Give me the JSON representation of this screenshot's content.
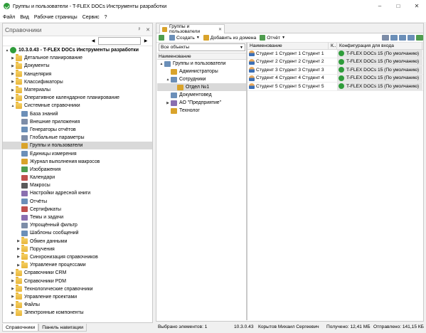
{
  "window": {
    "title": "Группы и пользователи - T-FLEX DOCs Инструменты разработки",
    "minimize": "–",
    "maximize": "□",
    "close": "✕"
  },
  "menu": [
    "Файл",
    "Вид",
    "Рабочие страницы",
    "Сервис",
    "?"
  ],
  "left_panel": {
    "title": "Справочники",
    "pin": "ᵖ",
    "close": "✕",
    "nav_prev": "◀",
    "nav_next": "▶",
    "tree": [
      {
        "label": "10.3.0.43 - T-FLEX DOCs Инструменты разработки",
        "level": 0,
        "toggle": "▲",
        "icon": "root",
        "bold": true
      },
      {
        "label": "Детальное планирование",
        "level": 1,
        "toggle": "▶",
        "icon": "folder"
      },
      {
        "label": "Документы",
        "level": 1,
        "toggle": "▶",
        "icon": "folder"
      },
      {
        "label": "Канцелярия",
        "level": 1,
        "toggle": "▶",
        "icon": "folder"
      },
      {
        "label": "Классификаторы",
        "level": 1,
        "toggle": "▶",
        "icon": "folder"
      },
      {
        "label": "Материалы",
        "level": 1,
        "toggle": "▶",
        "icon": "folder"
      },
      {
        "label": "Оперативное календарное планирование",
        "level": 1,
        "toggle": "▶",
        "icon": "folder"
      },
      {
        "label": "Системные справочники",
        "level": 1,
        "toggle": "▲",
        "icon": "folder"
      },
      {
        "label": "База знаний",
        "level": 2,
        "toggle": "",
        "icon": "gen c1"
      },
      {
        "label": "Внешние приложения",
        "level": 2,
        "toggle": "",
        "icon": "gen"
      },
      {
        "label": "Генераторы отчётов",
        "level": 2,
        "toggle": "",
        "icon": "gen c1"
      },
      {
        "label": "Глобальные параметры",
        "level": 2,
        "toggle": "",
        "icon": "gen"
      },
      {
        "label": "Группы и пользователи",
        "level": 2,
        "toggle": "",
        "icon": "gen c5",
        "selected": true
      },
      {
        "label": "Единицы измерения",
        "level": 2,
        "toggle": "",
        "icon": "gen c1"
      },
      {
        "label": "Журнал выполнения макросов",
        "level": 2,
        "toggle": "",
        "icon": "gen c5"
      },
      {
        "label": "Изображения",
        "level": 2,
        "toggle": "",
        "icon": "gen c3"
      },
      {
        "label": "Календари",
        "level": 2,
        "toggle": "",
        "icon": "gen c2"
      },
      {
        "label": "Макросы",
        "level": 2,
        "toggle": "",
        "icon": "gen c6"
      },
      {
        "label": "Настройки адресной книги",
        "level": 2,
        "toggle": "",
        "icon": "gen c4"
      },
      {
        "label": "Отчёты",
        "level": 2,
        "toggle": "",
        "icon": "gen c1"
      },
      {
        "label": "Сертификаты",
        "level": 2,
        "toggle": "",
        "icon": "gen c2"
      },
      {
        "label": "Темы и задачи",
        "level": 2,
        "toggle": "",
        "icon": "gen c4"
      },
      {
        "label": "Упрощённый фильтр",
        "level": 2,
        "toggle": "",
        "icon": "gen"
      },
      {
        "label": "Шаблоны сообщений",
        "level": 2,
        "toggle": "",
        "icon": "gen c1"
      },
      {
        "label": "Обмен данными",
        "level": 2,
        "toggle": "▶",
        "icon": "folder"
      },
      {
        "label": "Поручения",
        "level": 2,
        "toggle": "▶",
        "icon": "folder"
      },
      {
        "label": "Синхронизация справочников",
        "level": 2,
        "toggle": "▶",
        "icon": "folder"
      },
      {
        "label": "Управление процессами",
        "level": 2,
        "toggle": "▶",
        "icon": "folder"
      },
      {
        "label": "Справочники CRM",
        "level": 1,
        "toggle": "▶",
        "icon": "folder"
      },
      {
        "label": "Справочники PDM",
        "level": 1,
        "toggle": "▶",
        "icon": "folder"
      },
      {
        "label": "Технологические справочники",
        "level": 1,
        "toggle": "▶",
        "icon": "folder"
      },
      {
        "label": "Управление проектами",
        "level": 1,
        "toggle": "▶",
        "icon": "folder"
      },
      {
        "label": "Файлы",
        "level": 1,
        "toggle": "▶",
        "icon": "folder"
      },
      {
        "label": "Электронные компоненты",
        "level": 1,
        "toggle": "▶",
        "icon": "folder"
      }
    ],
    "tabs": [
      "Справочники",
      "Панель навигации"
    ]
  },
  "doc_tab": {
    "label": "Группы и пользователи",
    "close": "✕"
  },
  "toolbar": {
    "create": "Создать",
    "add_domain": "Добавить из домена",
    "reports": "Отчёт"
  },
  "objects": {
    "filter": "Все объекты",
    "column": "Наименование",
    "tree": [
      {
        "label": "Группы и пользователи",
        "level": 0,
        "toggle": "▲",
        "icon": "gen c1"
      },
      {
        "label": "Администраторы",
        "level": 1,
        "toggle": "",
        "icon": "gen c5"
      },
      {
        "label": "Сотрудники",
        "level": 1,
        "toggle": "▲",
        "icon": "gen c1"
      },
      {
        "label": "Отдел №1",
        "level": 2,
        "toggle": "",
        "icon": "gen c5",
        "selected": true
      },
      {
        "label": "Документовед",
        "level": 1,
        "toggle": "",
        "icon": "gen c1"
      },
      {
        "label": "АО \"Предприятие\"",
        "level": 1,
        "toggle": "▶",
        "icon": "gen c4"
      },
      {
        "label": "Технолог",
        "level": 1,
        "toggle": "",
        "icon": "gen c5"
      }
    ]
  },
  "grid": {
    "columns": [
      "Наименование",
      "К...",
      "Конфигурация для входа"
    ],
    "rows": [
      {
        "name": "Студент 1 Студент 1 Студент 1",
        "config": "T-FLEX DOCs 15 (По умолчанию)"
      },
      {
        "name": "Студент 2 Студент 2 Студент 2",
        "config": "T-FLEX DOCs 15 (По умолчанию)"
      },
      {
        "name": "Студент 3 Студент 3 Студент 3",
        "config": "T-FLEX DOCs 15 (По умолчанию)"
      },
      {
        "name": "Студент 4 Студент 4 Студент 4",
        "config": "T-FLEX DOCs 15 (По умолчанию)"
      },
      {
        "name": "Студент 5 Студент 5 Студент 5",
        "config": "T-FLEX DOCs 15 (По умолчанию)"
      }
    ]
  },
  "status": {
    "selected": "Выбрано элементов: 1",
    "server": "10.3.0.43",
    "user": "Корытов Михаил Сергеевич",
    "received": "Получено: 12,41 МБ",
    "sent": "Отправлено: 141,15 КБ"
  }
}
